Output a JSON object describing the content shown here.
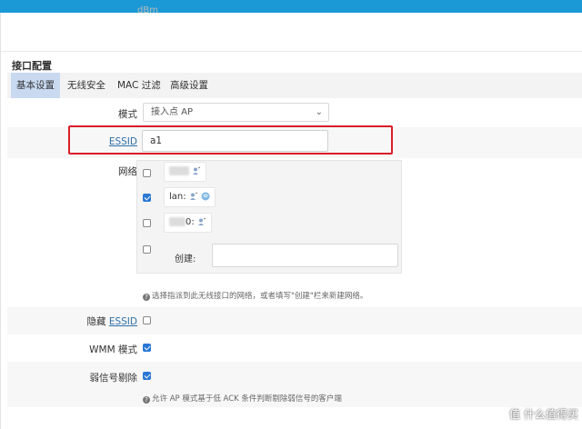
{
  "header": {
    "fragment_text": "dBm"
  },
  "section": {
    "title": "接口配置"
  },
  "tabs": [
    {
      "label": "基本设置",
      "active": true
    },
    {
      "label": "无线安全",
      "active": false
    },
    {
      "label": "MAC 过滤",
      "active": false
    },
    {
      "label": "高级设置",
      "active": false
    }
  ],
  "form": {
    "mode": {
      "label": "模式",
      "value": "接入点 AP"
    },
    "essid": {
      "label": "ESSID",
      "value": "a1"
    },
    "network": {
      "label": "网络",
      "items": [
        {
          "text": "",
          "checked": false
        },
        {
          "text": "lan:",
          "checked": true
        },
        {
          "text": "0:",
          "checked": false
        },
        {
          "text": "创建:",
          "checked": false
        }
      ],
      "hint": "选择指派到此无线接口的网络，或者填写\"创建\"栏来新建网络。"
    },
    "hidden": {
      "label": "隐藏",
      "link": "ESSID",
      "checked": false
    },
    "wmm": {
      "label": "WMM 模式",
      "checked": true
    },
    "weak_signal": {
      "label": "弱信号剔除",
      "checked": true,
      "hint": "允许 AP 模式基于低 ACK 条件判断剔除弱信号的客户端"
    }
  },
  "watermark": "值 什么值得买",
  "colors": {
    "accent": "#1a99d6",
    "highlight": "#d81e28",
    "tab_active": "#c8d9f0",
    "checkbox": "#2a78d3"
  }
}
